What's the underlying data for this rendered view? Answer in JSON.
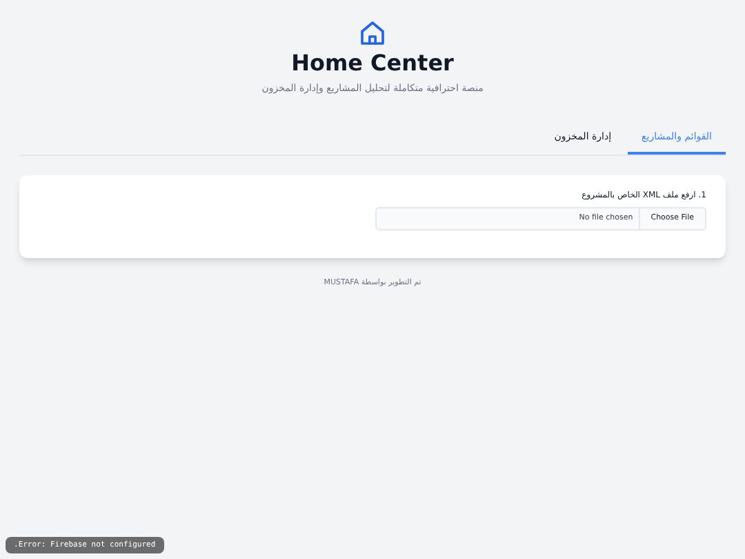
{
  "header": {
    "title": "Home Center",
    "subtitle": "منصة احترافية متكاملة لتحليل المشاريع وإدارة المخزون"
  },
  "tabs": [
    {
      "label": "القوائم والمشاريع",
      "selected": true
    },
    {
      "label": "إدارة المخزون",
      "selected": false
    }
  ],
  "upload": {
    "label": "1. ارفع ملف XML الخاص بالمشروع",
    "button": "Choose File",
    "status": "No file chosen"
  },
  "footer": "تم التطوير بواسطة MUSTAFA",
  "toast": "Error: Firebase not configured."
}
